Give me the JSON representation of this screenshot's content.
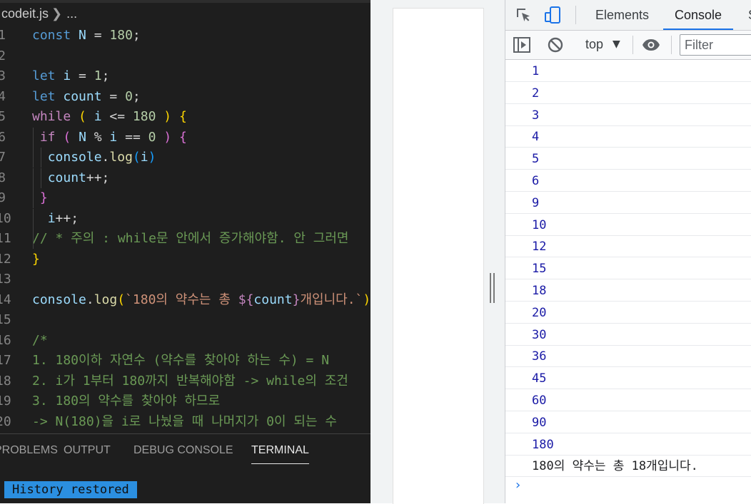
{
  "editor": {
    "breadcrumb": {
      "file": "codeit.js",
      "rest": "..."
    },
    "lines": [
      {
        "n": "1",
        "tokens": [
          [
            "kw",
            "const "
          ],
          [
            "id",
            "N"
          ],
          [
            "op",
            " = "
          ],
          [
            "num",
            "180"
          ],
          [
            "op",
            ";"
          ]
        ]
      },
      {
        "n": "2",
        "tokens": []
      },
      {
        "n": "3",
        "tokens": [
          [
            "kw",
            "let "
          ],
          [
            "id",
            "i"
          ],
          [
            "op",
            " = "
          ],
          [
            "num",
            "1"
          ],
          [
            "op",
            ";"
          ]
        ]
      },
      {
        "n": "4",
        "tokens": [
          [
            "kw",
            "let "
          ],
          [
            "id",
            "count"
          ],
          [
            "op",
            " = "
          ],
          [
            "num",
            "0"
          ],
          [
            "op",
            ";"
          ]
        ]
      },
      {
        "n": "5",
        "tokens": [
          [
            "cond",
            "while"
          ],
          [
            "op",
            " "
          ],
          [
            "br1",
            "("
          ],
          [
            "op",
            " "
          ],
          [
            "id",
            "i"
          ],
          [
            "op",
            " <= "
          ],
          [
            "num",
            "180"
          ],
          [
            "op",
            " "
          ],
          [
            "br1",
            ")"
          ],
          [
            "op",
            " "
          ],
          [
            "br1",
            "{"
          ]
        ]
      },
      {
        "n": "6",
        "tokens": [
          [
            "op",
            " "
          ],
          [
            "cond",
            "if"
          ],
          [
            "op",
            " "
          ],
          [
            "br2",
            "("
          ],
          [
            "op",
            " "
          ],
          [
            "id",
            "N"
          ],
          [
            "op",
            " % "
          ],
          [
            "id",
            "i"
          ],
          [
            "op",
            " == "
          ],
          [
            "num",
            "0"
          ],
          [
            "op",
            " "
          ],
          [
            "br2",
            ")"
          ],
          [
            "op",
            " "
          ],
          [
            "br2",
            "{"
          ]
        ]
      },
      {
        "n": "7",
        "tokens": [
          [
            "op",
            "  "
          ],
          [
            "id",
            "console"
          ],
          [
            "op",
            "."
          ],
          [
            "fn",
            "log"
          ],
          [
            "br3",
            "("
          ],
          [
            "id",
            "i"
          ],
          [
            "br3",
            ")"
          ]
        ]
      },
      {
        "n": "8",
        "tokens": [
          [
            "op",
            "  "
          ],
          [
            "id",
            "count"
          ],
          [
            "op",
            "++;"
          ]
        ]
      },
      {
        "n": "9",
        "tokens": [
          [
            "op",
            " "
          ],
          [
            "br2",
            "}"
          ]
        ]
      },
      {
        "n": "10",
        "tokens": [
          [
            "op",
            "  "
          ],
          [
            "id",
            "i"
          ],
          [
            "op",
            "++;"
          ]
        ]
      },
      {
        "n": "11",
        "tokens": [
          [
            "cm",
            "// * 주의 : while문 안에서 증가해야함. 안 그러면"
          ]
        ]
      },
      {
        "n": "12",
        "tokens": [
          [
            "br1",
            "}"
          ]
        ]
      },
      {
        "n": "13",
        "tokens": []
      },
      {
        "n": "14",
        "tokens": [
          [
            "id",
            "console"
          ],
          [
            "op",
            "."
          ],
          [
            "fn",
            "log"
          ],
          [
            "br1",
            "("
          ],
          [
            "str",
            "`180의 약수는 총 "
          ],
          [
            "cond",
            "${"
          ],
          [
            "id",
            "count"
          ],
          [
            "cond",
            "}"
          ],
          [
            "str",
            "개입니다.`"
          ],
          [
            "br1",
            ")"
          ],
          [
            "op",
            ";"
          ]
        ]
      },
      {
        "n": "15",
        "tokens": []
      },
      {
        "n": "16",
        "tokens": [
          [
            "cm",
            "/*"
          ]
        ]
      },
      {
        "n": "17",
        "tokens": [
          [
            "cm",
            "1. 180이하 자연수 (약수를 찾아야 하는 수) = N"
          ]
        ]
      },
      {
        "n": "18",
        "tokens": [
          [
            "cm",
            "2. i가 1부터 180까지 반복해야함 -> while의 조건"
          ]
        ]
      },
      {
        "n": "19",
        "tokens": [
          [
            "cm",
            "3. 180의 약수를 찾아야 하므로"
          ]
        ]
      },
      {
        "n": "20",
        "tokens": [
          [
            "cm",
            "-> N(180)을 i로 나눴을 때 나머지가 0이 되는 수"
          ]
        ]
      }
    ],
    "panel_tabs": [
      {
        "label": "PROBLEMS",
        "active": false
      },
      {
        "label": "OUTPUT",
        "active": false
      },
      {
        "label": "DEBUG CONSOLE",
        "active": false
      },
      {
        "label": "TERMINAL",
        "active": true
      }
    ],
    "terminal_message": "History restored"
  },
  "devtools": {
    "tabs": [
      {
        "label": "Elements",
        "active": false
      },
      {
        "label": "Console",
        "active": true
      },
      {
        "label": "S",
        "active": false
      }
    ],
    "toolbar": {
      "context": "top",
      "filter_placeholder": "Filter"
    },
    "console_output": [
      {
        "kind": "number",
        "text": "1"
      },
      {
        "kind": "number",
        "text": "2"
      },
      {
        "kind": "number",
        "text": "3"
      },
      {
        "kind": "number",
        "text": "4"
      },
      {
        "kind": "number",
        "text": "5"
      },
      {
        "kind": "number",
        "text": "6"
      },
      {
        "kind": "number",
        "text": "9"
      },
      {
        "kind": "number",
        "text": "10"
      },
      {
        "kind": "number",
        "text": "12"
      },
      {
        "kind": "number",
        "text": "15"
      },
      {
        "kind": "number",
        "text": "18"
      },
      {
        "kind": "number",
        "text": "20"
      },
      {
        "kind": "number",
        "text": "30"
      },
      {
        "kind": "number",
        "text": "36"
      },
      {
        "kind": "number",
        "text": "45"
      },
      {
        "kind": "number",
        "text": "60"
      },
      {
        "kind": "number",
        "text": "90"
      },
      {
        "kind": "number",
        "text": "180"
      },
      {
        "kind": "string",
        "text": "180의 약수는 총 18개입니다."
      }
    ],
    "prompt": "›"
  },
  "colors": {
    "editor_bg": "#1e1e1e",
    "devtools_accent": "#1a73e8",
    "console_number": "#1a1aa6",
    "terminal_highlight": "#2b8fe0"
  },
  "icons": [
    "chevron-right-icon",
    "inspect-element-icon",
    "device-toolbar-icon",
    "sidebar-toggle-icon",
    "clear-console-icon",
    "dropdown-arrow-icon",
    "eye-icon",
    "console-prompt-icon"
  ]
}
